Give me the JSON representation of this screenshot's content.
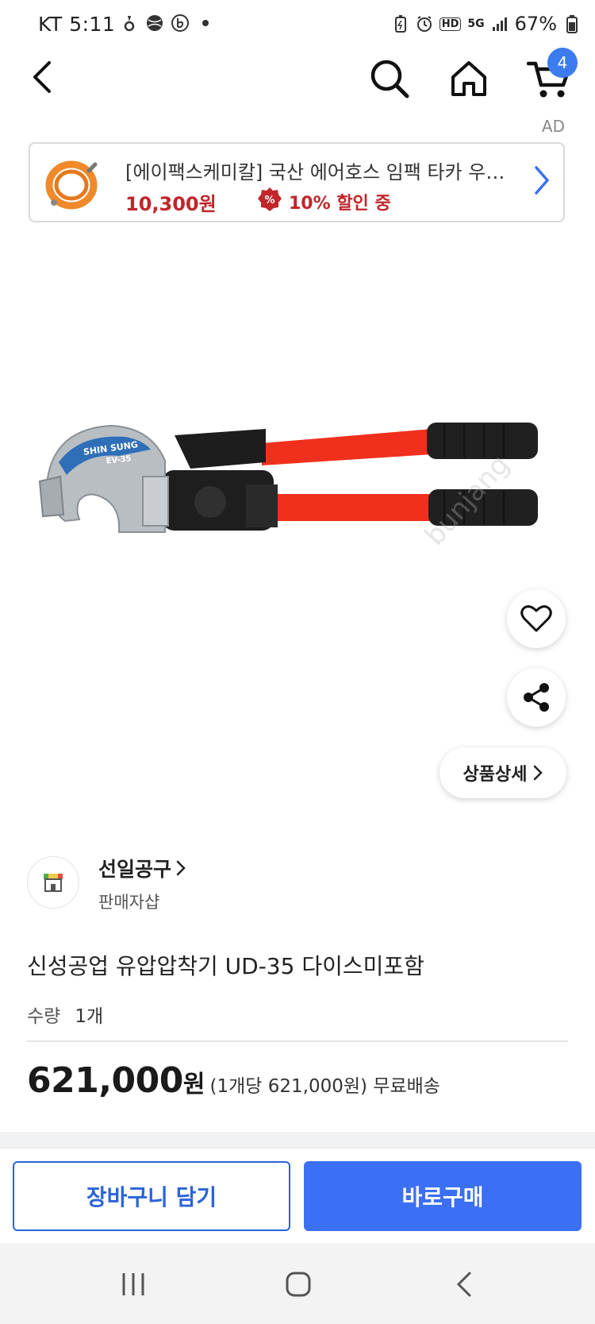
{
  "status_bar": {
    "carrier": "KT",
    "time": "5:11",
    "network_badge": "HD",
    "network_type": "5G",
    "battery": "67%"
  },
  "app_bar": {
    "cart_count": "4"
  },
  "ad": {
    "label": "AD",
    "title": "[에이팩스케미칼] 국산 에어호스 임팩 타카 우레탄",
    "price": "10,300원",
    "discount_badge": "%",
    "discount": "10% 할인 중"
  },
  "product_image": {
    "brand_text": "SHIN SUNG",
    "model_text": "EV-35"
  },
  "buttons": {
    "detail": "상품상세"
  },
  "seller": {
    "name": "선일공구",
    "type": "판매자샵"
  },
  "product": {
    "title": "신성공업 유압압착기 UD-35 다이스미포함",
    "qty_label": "수량",
    "qty_value": "1개",
    "price": "621,000",
    "price_unit": "원",
    "price_info": "(1개당 621,000원) 무료배송"
  },
  "bottom": {
    "cart_button": "장바구니 담기",
    "buy_button": "바로구매"
  },
  "colors": {
    "accent": "#3b6ff4",
    "sale_red": "#c0262b",
    "handle_red": "#f0301c"
  }
}
